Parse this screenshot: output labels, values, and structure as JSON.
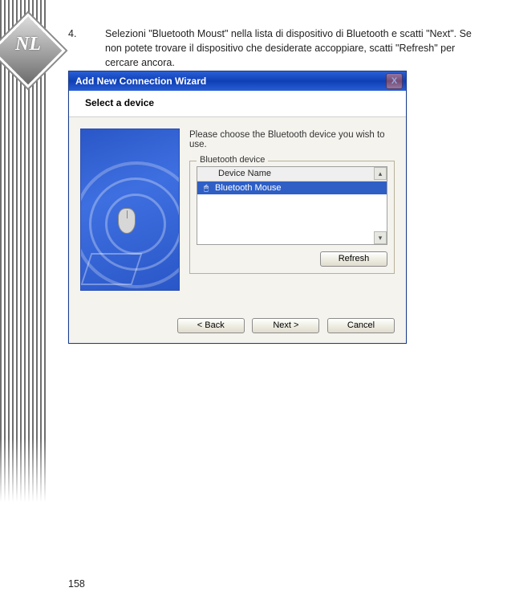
{
  "decor": {
    "nl": "NL"
  },
  "instruction": {
    "number": "4.",
    "text": "Selezioni \"Bluetooth Moust\" nella lista di dispositivo di Bluetooth e scatti \"Next\". Se non potete trovare il dispositivo che desiderate accoppiare, scatti \"Refresh\" per cercare ancora."
  },
  "wizard": {
    "title": "Add New Connection Wizard",
    "close": "X",
    "subheader": "Select a device",
    "prompt": "Please choose the Bluetooth device you wish to use.",
    "fieldset_label": "Bluetooth device",
    "list_header": "Device Name",
    "selected_device": "Bluetooth Mouse",
    "scroll_up": "▴",
    "scroll_down": "▾",
    "buttons": {
      "refresh": "Refresh",
      "back": "< Back",
      "next": "Next >",
      "cancel": "Cancel"
    }
  },
  "page_number": "158"
}
